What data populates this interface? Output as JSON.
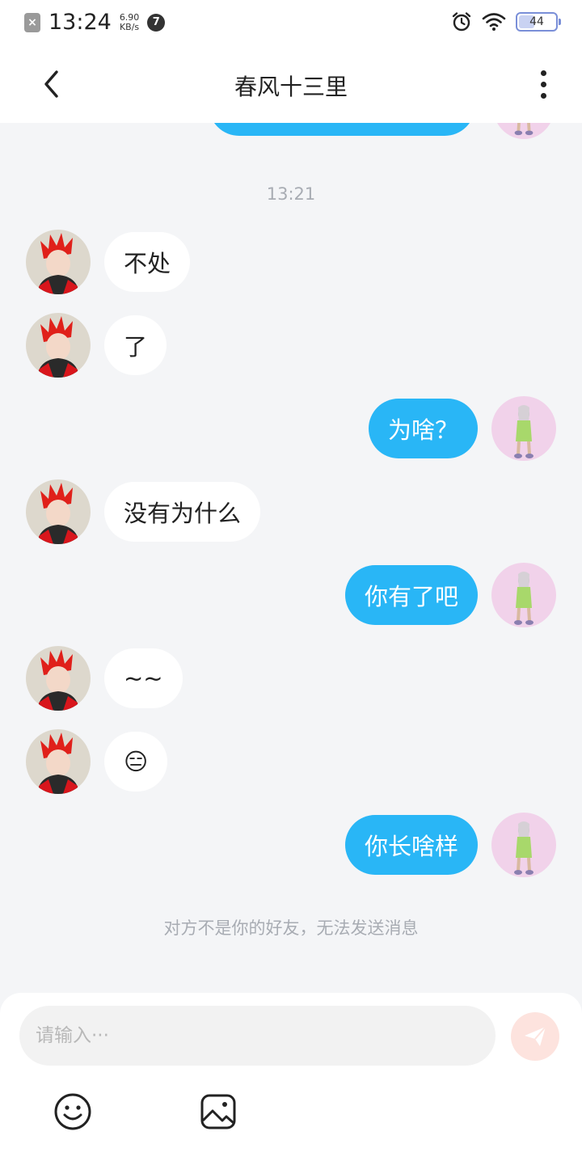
{
  "status_bar": {
    "time": "13:24",
    "speed_value": "6.90",
    "speed_unit": "KB/s",
    "notification_count": "7",
    "battery": "44",
    "icons": [
      "notification-off-icon",
      "alarm-icon",
      "wifi-icon",
      "battery-icon"
    ]
  },
  "header": {
    "title": "春风十三里",
    "back_icon": "chevron-left-icon",
    "more_icon": "more-vertical-icon"
  },
  "chat": {
    "timestamp": "13:21",
    "messages": [
      {
        "side": "in",
        "text": "不处"
      },
      {
        "side": "in",
        "text": "了"
      },
      {
        "side": "out",
        "text": "为啥？"
      },
      {
        "side": "in",
        "text": "没有为什么"
      },
      {
        "side": "out",
        "text": "你有了吧"
      },
      {
        "side": "in",
        "text": "~~"
      },
      {
        "side": "in",
        "text": "😑"
      },
      {
        "side": "out",
        "text": "你长啥样"
      }
    ],
    "notice": "对方不是你的好友，无法发送消息"
  },
  "composer": {
    "placeholder": "请输入···",
    "send_icon": "send-icon",
    "emoji_icon": "emoji-icon",
    "image_icon": "image-icon"
  },
  "colors": {
    "outgoing_bubble": "#29b6f6",
    "incoming_bubble": "#ffffff",
    "background": "#f4f5f7",
    "send_button": "#fde3de"
  }
}
